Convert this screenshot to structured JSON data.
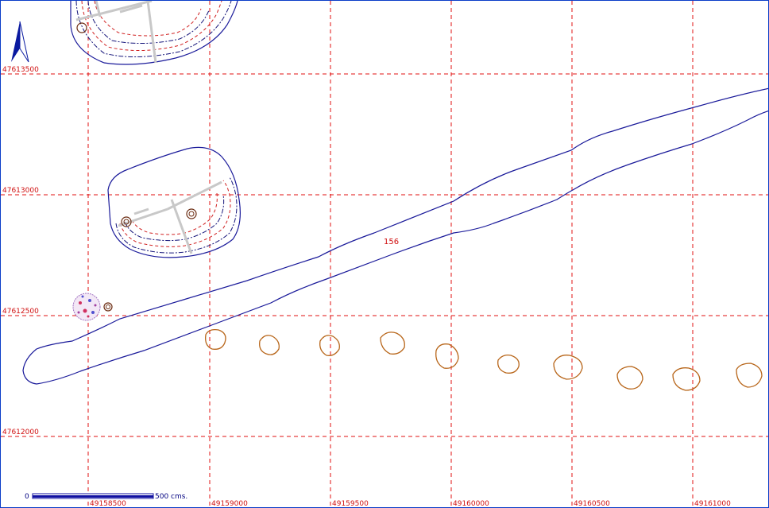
{
  "map": {
    "north_arrow_icon": "north-arrow-icon",
    "contour_label": "156",
    "grid": {
      "y_labels": [
        "47613500",
        "47613000",
        "47612500",
        "47612000"
      ],
      "x_labels": [
        "49158500",
        "49159000",
        "49159500",
        "49160000",
        "49160500",
        "49161000"
      ]
    },
    "scale_bar": {
      "start_label": "0",
      "end_label": "500",
      "unit_label": "cms."
    },
    "colors": {
      "grid": "#e01010",
      "contour": "#1a1a9a",
      "pits": "#b8661a",
      "frame": "#0a3dc8"
    }
  }
}
